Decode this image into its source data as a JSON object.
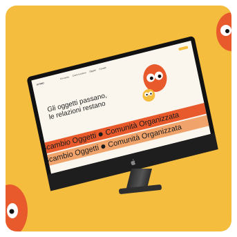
{
  "site": {
    "logo": "ATTIMO",
    "nav_links": [
      "Chi siamo",
      "Come funziona",
      "Oggetti",
      "Contatti"
    ],
    "headline": "Gli oggetti passano,\nle relazioni restano",
    "band_items": [
      "Scambio Oggetti",
      "Comunità Organizzata"
    ],
    "band_items_repeat": [
      "Scambio Oggetti",
      "Comunità Organizzata"
    ]
  },
  "colors": {
    "background": "#f5bd3e",
    "mascot": "#e85a2c",
    "band": "#e85a2c",
    "device": "#1e1e1e"
  },
  "icons": [
    "eyes-mascot-icon",
    "apple-logo-icon"
  ]
}
